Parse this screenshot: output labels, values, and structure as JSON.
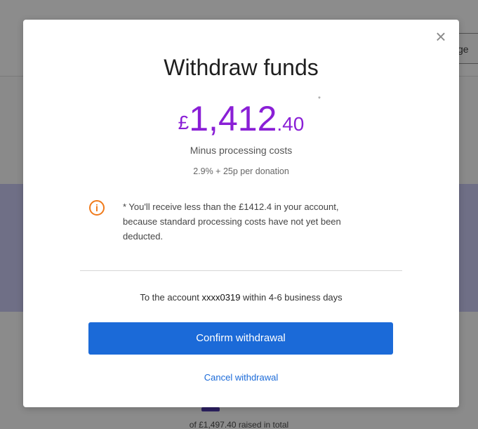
{
  "background": {
    "button_text": "ge",
    "raised_text": "of £1,497.40 raised in total"
  },
  "modal": {
    "close_glyph": "×",
    "title": "Withdraw funds",
    "amount": {
      "currency": "£",
      "main": "1,412",
      "decimal": ".40",
      "asterisk": "*"
    },
    "minus_text": "Minus processing costs",
    "rate_text": "2.9% + 25p per donation",
    "info_glyph": "i",
    "notice_text": "* You'll receive less than the £1412.4 in your account, because standard processing costs have not yet been deducted.",
    "account_prefix": "To the account ",
    "account_number": "xxxx0319",
    "account_suffix": " within 4-6 business days",
    "confirm_label": "Confirm withdrawal",
    "cancel_label": "Cancel withdrawal"
  },
  "colors": {
    "accent_purple": "#8a1fd6",
    "primary_blue": "#1b6ad8",
    "warning_orange": "#f07a1a"
  }
}
